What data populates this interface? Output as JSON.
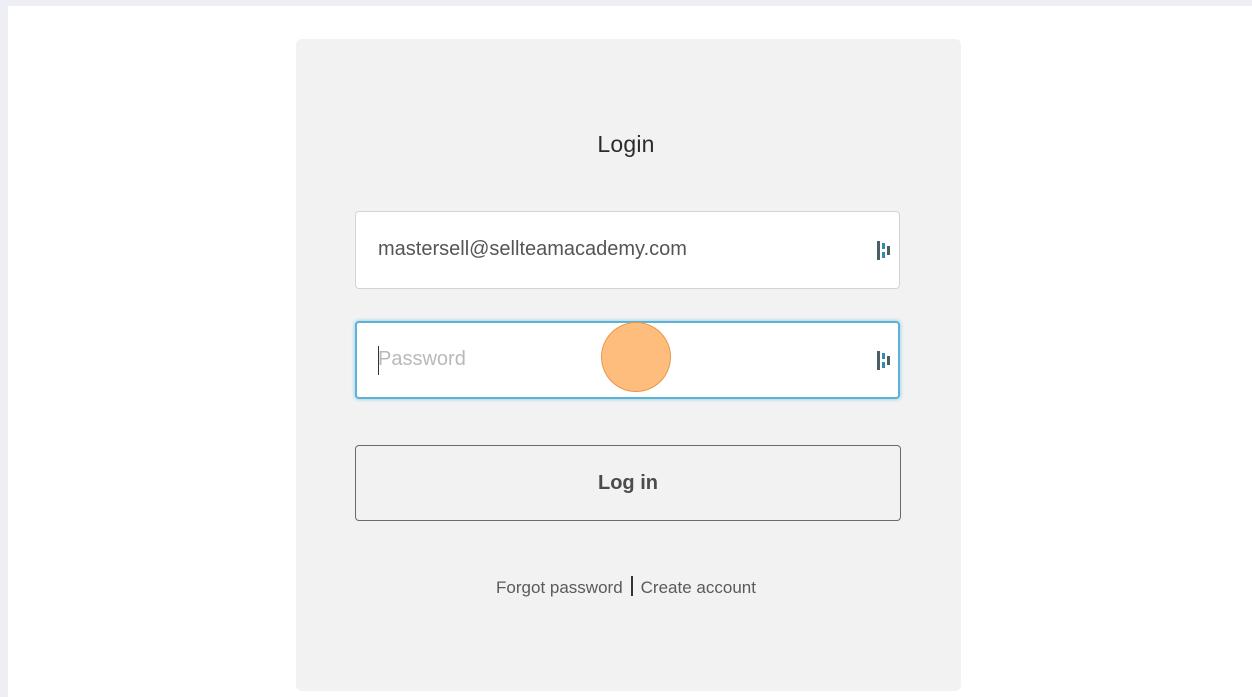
{
  "login": {
    "title": "Login",
    "email": {
      "value": "mastersell@sellteamacademy.com",
      "icon": "password-manager-icon"
    },
    "password": {
      "value": "",
      "placeholder": "Password",
      "icon": "password-manager-icon"
    },
    "submit_label": "Log in",
    "links": {
      "forgot": "Forgot password",
      "separator": "|",
      "create": "Create account"
    }
  },
  "colors": {
    "page_background": "#eeeef5",
    "viewport_background": "#ffffff",
    "card_background": "#f2f2f2",
    "focus_border": "#5ab2d6",
    "click_marker": "#ffb266"
  }
}
